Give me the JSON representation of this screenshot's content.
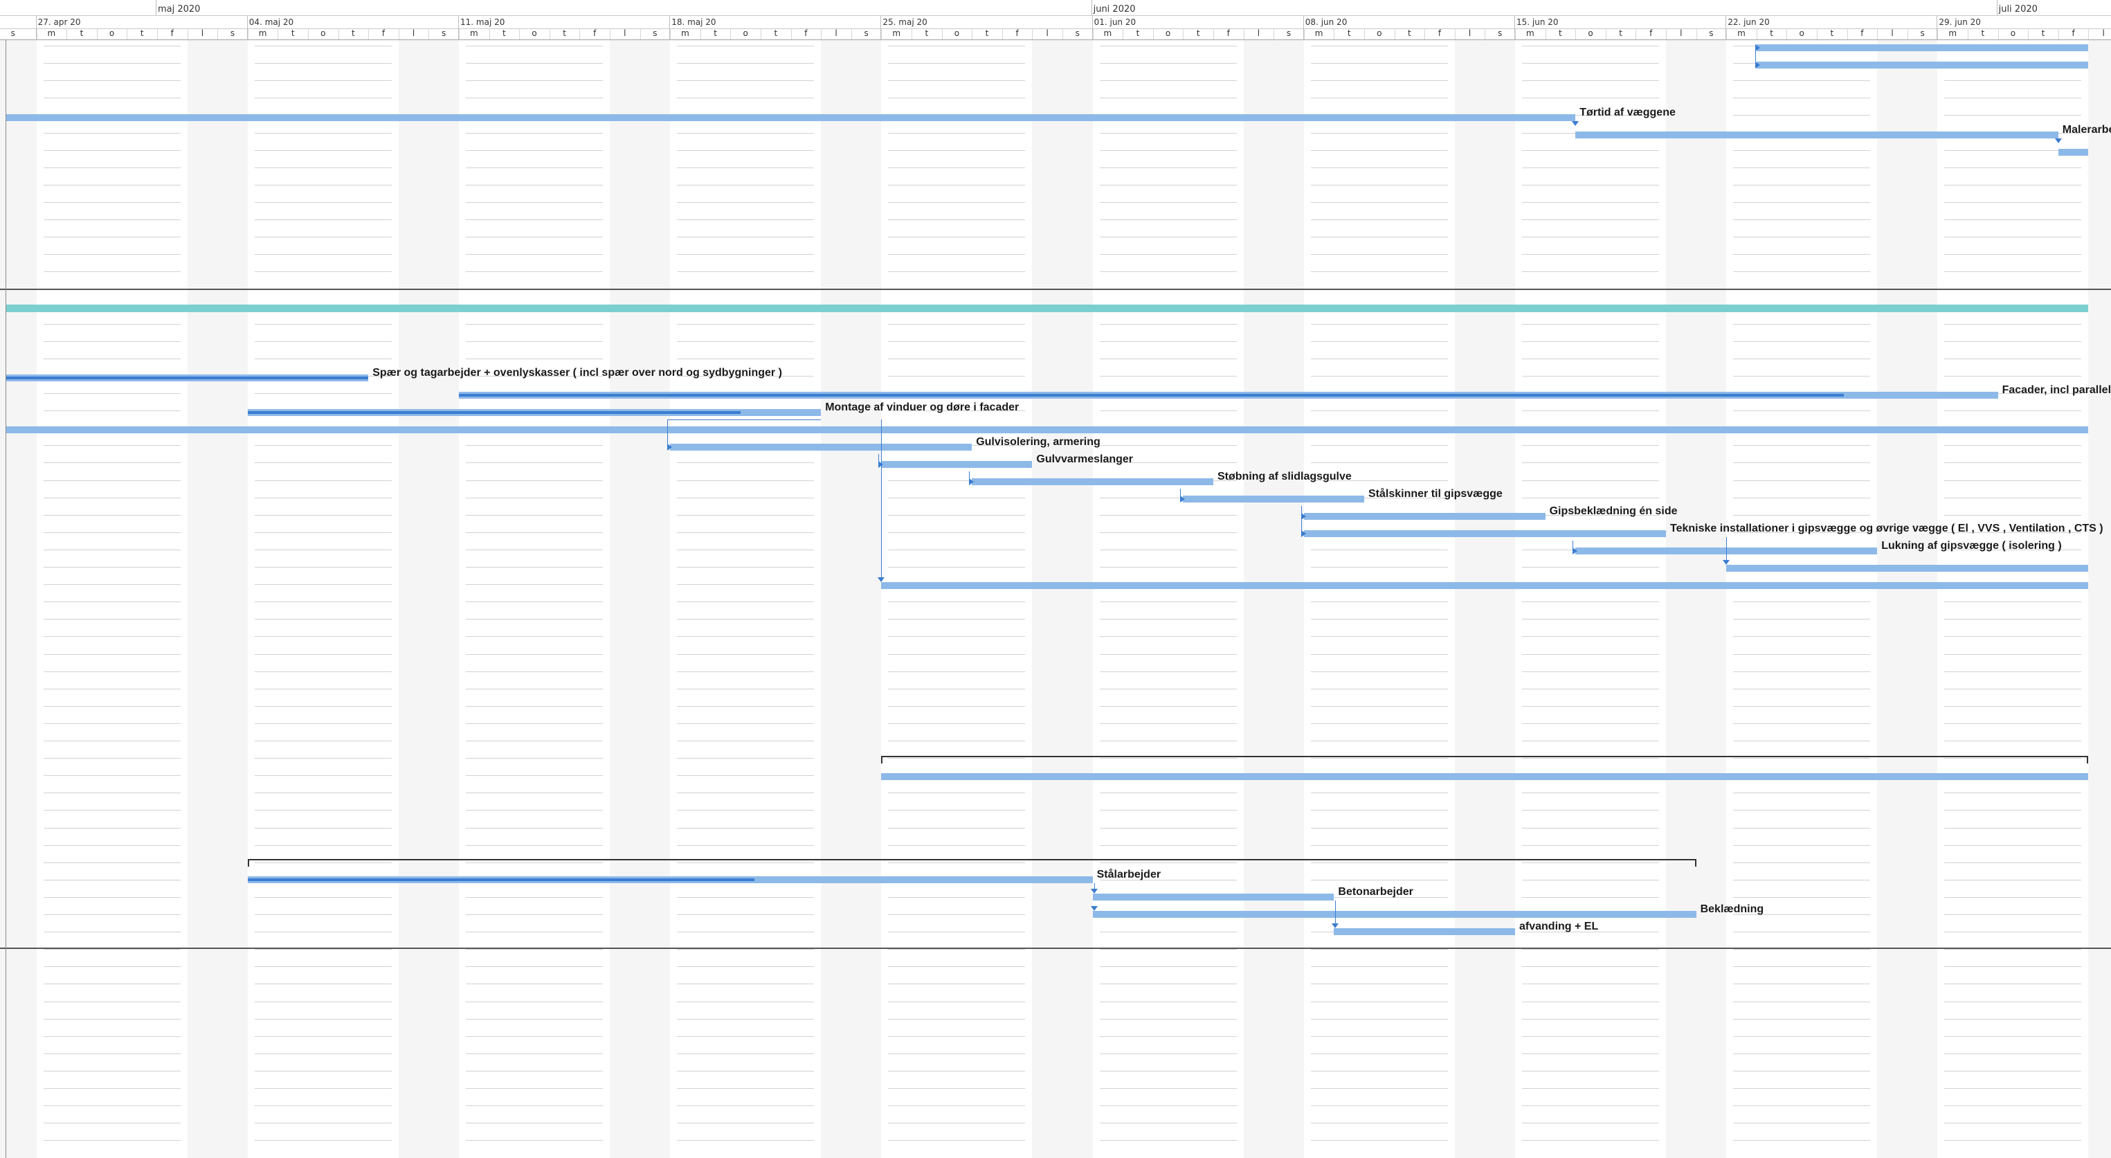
{
  "months": [
    {
      "id": "may",
      "label": "maj 2020"
    },
    {
      "id": "jun",
      "label": "juni 2020"
    },
    {
      "id": "jul",
      "label": "juli 2020"
    }
  ],
  "weeks": [
    {
      "id": "w0",
      "label": "27. apr 20"
    },
    {
      "id": "w1",
      "label": "04. maj 20"
    },
    {
      "id": "w2",
      "label": "11. maj 20"
    },
    {
      "id": "w3",
      "label": "18. maj 20"
    },
    {
      "id": "w4",
      "label": "25. maj 20"
    },
    {
      "id": "w5",
      "label": "01. jun 20"
    },
    {
      "id": "w6",
      "label": "08. jun 20"
    },
    {
      "id": "w7",
      "label": "15. jun 20"
    },
    {
      "id": "w8",
      "label": "22. jun 20"
    },
    {
      "id": "w9",
      "label": "29. jun 20"
    }
  ],
  "day_letters": [
    "m",
    "t",
    "o",
    "t",
    "f",
    "l",
    "s"
  ],
  "lead_day_letter": "s",
  "timeline_start": "2020-04-26",
  "colors": {
    "bar": "#8db9e8",
    "progress": "#3b7dd0",
    "milestone_bar": "#7ccfcf",
    "weekend": "#f5f5f5",
    "summary": "#333333"
  },
  "tasks": [
    {
      "id": "t_r1a",
      "start": "2020-06-23",
      "end": "2020-07-04",
      "label": ""
    },
    {
      "id": "t_r1b",
      "start": "2020-06-23",
      "end": "2020-07-04",
      "label": ""
    },
    {
      "id": "t_tortid",
      "start": "2020-04-26",
      "end": "2020-06-17",
      "label": "Tørtid af væggene"
    },
    {
      "id": "t_maler1",
      "start": "2020-06-17",
      "end": "2020-07-03",
      "label": "Malerarbejde"
    },
    {
      "id": "t_maler2",
      "start": "2020-07-03",
      "end": "2020-07-04",
      "label": ""
    },
    {
      "id": "t_spaer",
      "start": "2020-04-26",
      "end": "2020-05-08",
      "label": "Spær og tagarbejder + ovenlyskasser ( incl spær over nord og sydbygninger )",
      "progress": 1.0
    },
    {
      "id": "t_facader",
      "start": "2020-05-11",
      "end": "2020-07-01",
      "label": "Facader, incl paralleldele",
      "progress": 0.9
    },
    {
      "id": "t_montage",
      "start": "2020-05-04",
      "end": "2020-05-23",
      "label": "Montage af vinduer og døre i facader",
      "progress": 0.86
    },
    {
      "id": "t_long1",
      "start": "2020-04-26",
      "end": "2020-07-04",
      "label": ""
    },
    {
      "id": "t_gulviso",
      "start": "2020-05-18",
      "end": "2020-05-28",
      "label": "Gulvisolering, armering"
    },
    {
      "id": "t_gulvvarme",
      "start": "2020-05-25",
      "end": "2020-05-30",
      "label": "Gulvvarmeslanger"
    },
    {
      "id": "t_stobning",
      "start": "2020-05-28",
      "end": "2020-06-05",
      "label": "Støbning af slidlagsgulve"
    },
    {
      "id": "t_stalsk",
      "start": "2020-06-04",
      "end": "2020-06-10",
      "label": "Stålskinner til gipsvægge"
    },
    {
      "id": "t_gipsbekl",
      "start": "2020-06-08",
      "end": "2020-06-16",
      "label": "Gipsbeklædning én side"
    },
    {
      "id": "t_tekniske",
      "start": "2020-06-08",
      "end": "2020-06-20",
      "label": "Tekniske installationer i gipsvægge og øvrige vægge ( El , VVS , Ventilation , CTS )"
    },
    {
      "id": "t_lukning",
      "start": "2020-06-17",
      "end": "2020-06-27",
      "label": "Lukning af gipsvægge ( isolering )"
    },
    {
      "id": "t_after_luk",
      "start": "2020-06-22",
      "end": "2020-07-04",
      "label": ""
    },
    {
      "id": "t_long2",
      "start": "2020-05-25",
      "end": "2020-07-04",
      "label": ""
    },
    {
      "id": "t_long3",
      "start": "2020-05-25",
      "end": "2020-07-04",
      "label": ""
    },
    {
      "id": "t_stal",
      "start": "2020-05-04",
      "end": "2020-06-01",
      "label": "Stålarbejder",
      "progress": 0.6
    },
    {
      "id": "t_beton",
      "start": "2020-06-01",
      "end": "2020-06-09",
      "label": "Betonarbejder"
    },
    {
      "id": "t_bekl",
      "start": "2020-06-01",
      "end": "2020-06-21",
      "label": "Beklædning"
    },
    {
      "id": "t_afvand",
      "start": "2020-06-09",
      "end": "2020-06-15",
      "label": "afvanding + EL"
    }
  ],
  "milestone_bar": {
    "start": "2020-04-26",
    "end": "2020-07-04"
  },
  "summaries": [
    {
      "id": "s1",
      "start": "2020-05-25",
      "end": "2020-07-04"
    },
    {
      "id": "s2",
      "start": "2020-05-04",
      "end": "2020-06-21"
    }
  ]
}
